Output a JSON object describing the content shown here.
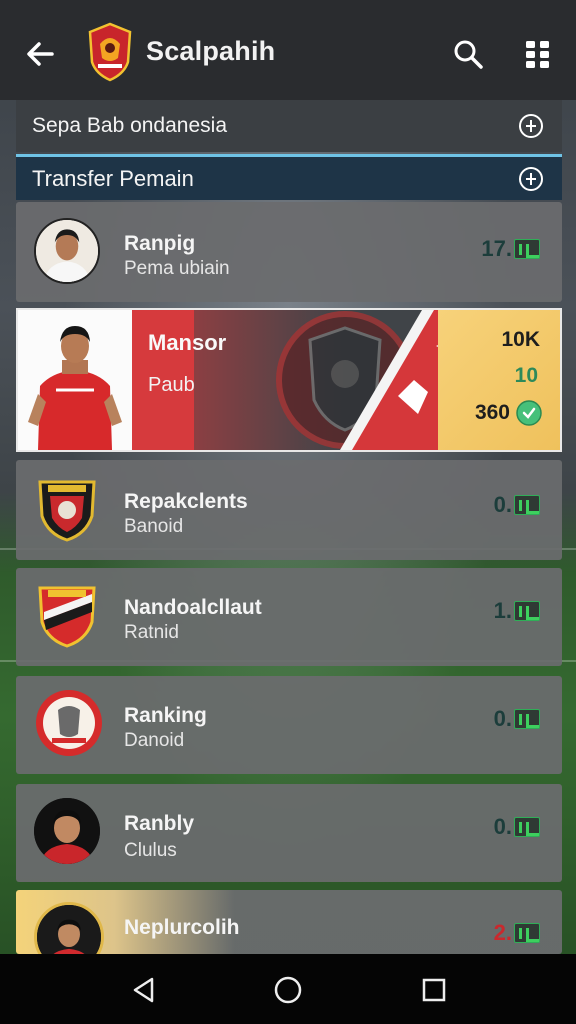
{
  "appbar": {
    "title": "Scalpahih",
    "back_icon": "arrow-left-icon",
    "logo_icon": "club-crest-icon",
    "search_icon": "search-icon",
    "menu_icon": "grid-menu-icon"
  },
  "sections": [
    {
      "label": "Sepa Bab ondanesia",
      "icon": "plus-circle-icon"
    },
    {
      "label": "Transfer Pemain",
      "icon": "plus-circle-icon"
    }
  ],
  "rows": [
    {
      "title": "Ranpig",
      "subtitle": "Pema ubiain",
      "value": "17.",
      "avatar": "player-photo"
    },
    {
      "title": "Repakclents",
      "subtitle": "Banoid",
      "value": "0.",
      "avatar": "club-crest"
    },
    {
      "title": "Nandoalcllaut",
      "subtitle": "Ratnid",
      "value": "1.",
      "avatar": "club-crest"
    },
    {
      "title": "Ranking",
      "subtitle": "Danoid",
      "value": "0.",
      "avatar": "club-crest"
    },
    {
      "title": "Ranbly",
      "subtitle": "Clulus",
      "value": "0.",
      "avatar": "player-photo"
    },
    {
      "title": "Neplurcolih",
      "subtitle": "",
      "value": "2.",
      "avatar": "player-photo"
    }
  ],
  "featured": {
    "name": "Mansor",
    "subtitle": "Paub",
    "stat1": "10K",
    "stat2": "10",
    "stat3": "360"
  },
  "colors": {
    "appbar": "#2a2c2f",
    "accent_blue": "#6fc3e6",
    "red": "#d63a3d",
    "gold": "#f4d37a",
    "green": "#3dd05e"
  },
  "nav": {
    "back_icon": "nav-back-triangle-icon",
    "home_icon": "nav-home-circle-icon",
    "recents_icon": "nav-recents-square-icon"
  }
}
